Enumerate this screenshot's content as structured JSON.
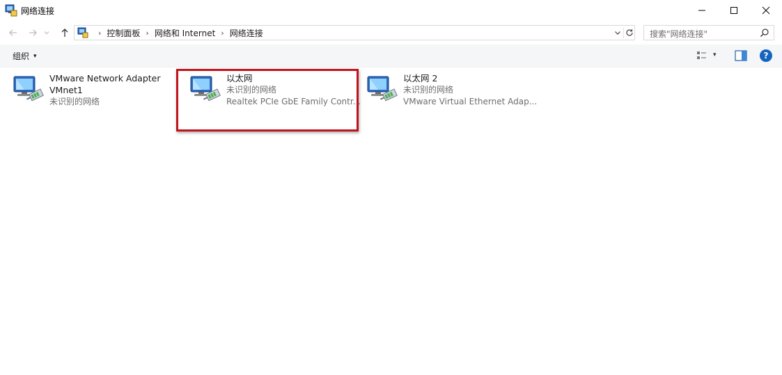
{
  "window": {
    "title": "网络连接",
    "icon": "network-connections-icon",
    "controls": {
      "minimize": "minimize-icon",
      "maximize": "maximize-icon",
      "close": "close-icon"
    }
  },
  "navigation": {
    "back_icon": "arrow-left-icon",
    "forward_icon": "arrow-right-icon",
    "recent_icon": "chevron-down-icon",
    "up_icon": "arrow-up-icon"
  },
  "address": {
    "icon": "control-panel-icon",
    "breadcrumbs": [
      "控制面板",
      "网络和 Internet",
      "网络连接"
    ],
    "separator": "›"
  },
  "search": {
    "placeholder": "搜索\"网络连接\""
  },
  "toolbar": {
    "organize_label": "组织",
    "organize_caret": "▾",
    "view_caret": "▾",
    "help_label": "?"
  },
  "connections": [
    {
      "name_line1": "VMware Network Adapter",
      "name_line2": "VMnet1",
      "status": "未识别的网络",
      "device": ""
    },
    {
      "name_line1": "以太网",
      "name_line2": "",
      "status": "未识别的网络",
      "device": "Realtek PCIe GbE Family Contr..."
    },
    {
      "name_line1": "以太网 2",
      "name_line2": "",
      "status": "未识别的网络",
      "device": "VMware Virtual Ethernet Adap..."
    }
  ],
  "colors": {
    "highlight_border": "#c0141c",
    "help_blue": "#1565c0",
    "secondary_text": "#6d6d6d"
  }
}
